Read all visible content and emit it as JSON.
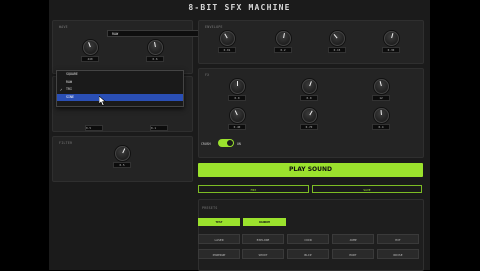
{
  "app": {
    "title": "8-BIT SFX MACHINE"
  },
  "wave": {
    "section_label": "WAVE",
    "selected": "RAW",
    "options": [
      "SQUARE",
      "RAW",
      "TRI",
      "SINE"
    ],
    "checked_option": "TRI",
    "highlighted_option": "SINE",
    "knobs": [
      {
        "label": "",
        "value": "440"
      },
      {
        "label": "",
        "value": "0.6"
      }
    ],
    "lower_values": [
      "0.5",
      "0.1"
    ]
  },
  "envelope": {
    "section_label": "ENVELOPE",
    "knobs": [
      {
        "value": "0.01"
      },
      {
        "value": "0.2"
      },
      {
        "value": "0.15"
      },
      {
        "value": "0.30"
      }
    ]
  },
  "fx": {
    "section_label": "FX",
    "knobs_row1": [
      {
        "value": "0.0"
      },
      {
        "value": "0.0"
      },
      {
        "value": "12"
      }
    ],
    "knobs_row2": [
      {
        "value": "0.40"
      },
      {
        "value": "0.70"
      },
      {
        "value": "0.4"
      }
    ],
    "toggle_label_left": "CRUSH",
    "toggle_label_right": "ON",
    "toggle_on": true
  },
  "extra": {
    "section_label": "FILTER",
    "value": "0.5"
  },
  "actions": {
    "play_label": "PLAY SOUND",
    "sub_buttons": [
      "MIX",
      "SAVE"
    ]
  },
  "presets": {
    "section_label": "PRESETS",
    "mode_buttons": [
      "TEST",
      "RANDOM"
    ],
    "row1": [
      "LASER",
      "EXPLODE",
      "COIN",
      "JUMP",
      "HIT"
    ],
    "row2": [
      "POWERUP",
      "SHOOT",
      "BLIP",
      "HURT",
      "NOISE"
    ]
  },
  "colors": {
    "accent": "#9be22d",
    "selection": "#2a4fb5",
    "panel": "#242424"
  }
}
